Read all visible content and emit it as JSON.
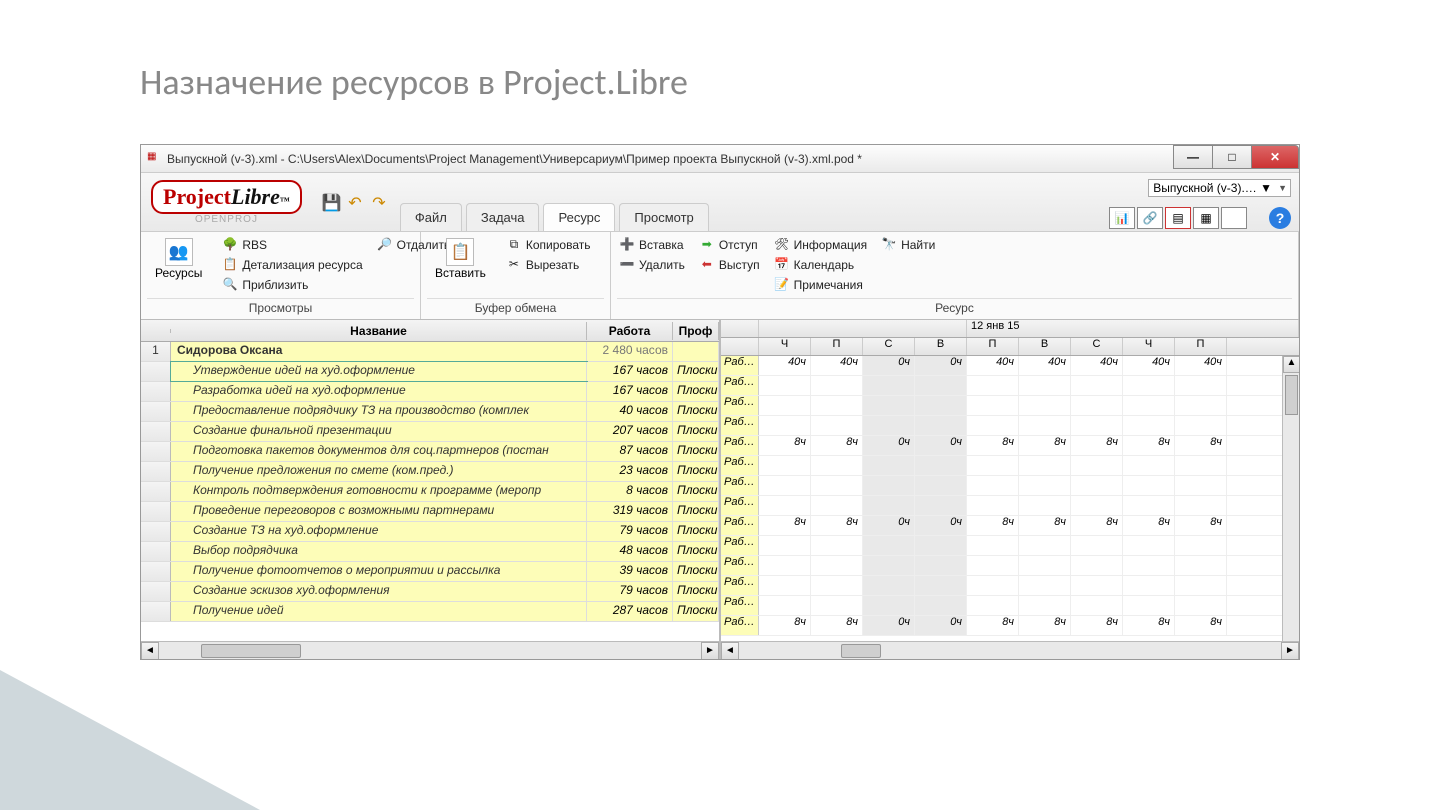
{
  "slide_title": "Назначение ресурсов в Project.Libre",
  "window": {
    "title": "Выпускной (v-3).xml - C:\\Users\\Alex\\Documents\\Project Management\\Универсариум\\Пример проекта Выпускной (v-3).xml.pod *",
    "brand_proj": "Project",
    "brand_libre": "Libre",
    "brand_tm": "™",
    "openproj": "OPENPROJ",
    "combo_text": "Выпускной (v-3).… ▼",
    "help": "?"
  },
  "tabs": {
    "file": "Файл",
    "task": "Задача",
    "resource": "Ресурс",
    "view": "Просмотр"
  },
  "ribbon": {
    "views_group": "Просмотры",
    "views_btn": "Ресурсы",
    "rbs": "RBS",
    "detail": "Детализация ресурса",
    "zoomin": "Приблизить",
    "zoomout": "Отдалить",
    "clipboard_group": "Буфер обмена",
    "paste": "Вставить",
    "copy": "Копировать",
    "cut": "Вырезать",
    "resource_group": "Ресурс",
    "insert": "Вставка",
    "delete": "Удалить",
    "indent": "Отступ",
    "outdent": "Выступ",
    "info": "Информация",
    "calendar": "Календарь",
    "notes": "Примечания",
    "find": "Найти"
  },
  "grid": {
    "col_name": "Название",
    "col_work": "Работа",
    "col_prof": "Проф",
    "date_header": "12 янв 15",
    "days": [
      "Ч",
      "П",
      "С",
      "В",
      "П",
      "В",
      "С",
      "Ч",
      "П"
    ],
    "rowlabel": "Раб…",
    "rows": [
      {
        "id": "1",
        "lvl": 1,
        "name": "Сидорова Оксана",
        "work": "2 480 часов",
        "prof": "",
        "vals": [
          "40ч",
          "40ч",
          "0ч",
          "0ч",
          "40ч",
          "40ч",
          "40ч",
          "40ч",
          "40ч"
        ]
      },
      {
        "id": "",
        "lvl": 2,
        "name": "Утверждение идей на худ.оформление",
        "work": "167 часов",
        "prof": "Плоски",
        "vals": [
          "",
          "",
          "",
          "",
          "",
          "",
          "",
          "",
          ""
        ]
      },
      {
        "id": "",
        "lvl": 2,
        "name": "Разработка идей на худ.оформление",
        "work": "167 часов",
        "prof": "Плоски",
        "vals": [
          "",
          "",
          "",
          "",
          "",
          "",
          "",
          "",
          ""
        ]
      },
      {
        "id": "",
        "lvl": 2,
        "name": "Предоставление подрядчику ТЗ на производство (комплек",
        "work": "40 часов",
        "prof": "Плоски",
        "vals": [
          "",
          "",
          "",
          "",
          "",
          "",
          "",
          "",
          ""
        ]
      },
      {
        "id": "",
        "lvl": 2,
        "name": "Создание финальной презентации",
        "work": "207 часов",
        "prof": "Плоски",
        "vals": [
          "8ч",
          "8ч",
          "0ч",
          "0ч",
          "8ч",
          "8ч",
          "8ч",
          "8ч",
          "8ч"
        ]
      },
      {
        "id": "",
        "lvl": 2,
        "name": "Подготовка пакетов документов для соц.партнеров (постан",
        "work": "87 часов",
        "prof": "Плоски",
        "vals": [
          "",
          "",
          "",
          "",
          "",
          "",
          "",
          "",
          ""
        ]
      },
      {
        "id": "",
        "lvl": 2,
        "name": "Получение предложения по смете (ком.пред.)",
        "work": "23 часов",
        "prof": "Плоски",
        "vals": [
          "",
          "",
          "",
          "",
          "",
          "",
          "",
          "",
          ""
        ]
      },
      {
        "id": "",
        "lvl": 2,
        "name": "Контроль подтверждения готовности к программе (меропр",
        "work": "8 часов",
        "prof": "Плоски",
        "vals": [
          "",
          "",
          "",
          "",
          "",
          "",
          "",
          "",
          ""
        ]
      },
      {
        "id": "",
        "lvl": 2,
        "name": "Проведение переговоров с возможными партнерами",
        "work": "319 часов",
        "prof": "Плоски",
        "vals": [
          "8ч",
          "8ч",
          "0ч",
          "0ч",
          "8ч",
          "8ч",
          "8ч",
          "8ч",
          "8ч"
        ]
      },
      {
        "id": "",
        "lvl": 2,
        "name": "Создание ТЗ на худ.оформление",
        "work": "79 часов",
        "prof": "Плоски",
        "vals": [
          "",
          "",
          "",
          "",
          "",
          "",
          "",
          "",
          ""
        ]
      },
      {
        "id": "",
        "lvl": 2,
        "name": "Выбор подрядчика",
        "work": "48 часов",
        "prof": "Плоски",
        "vals": [
          "",
          "",
          "",
          "",
          "",
          "",
          "",
          "",
          ""
        ]
      },
      {
        "id": "",
        "lvl": 2,
        "name": "Получение фотоотчетов о мероприятии и рассылка",
        "work": "39 часов",
        "prof": "Плоски",
        "vals": [
          "",
          "",
          "",
          "",
          "",
          "",
          "",
          "",
          ""
        ]
      },
      {
        "id": "",
        "lvl": 2,
        "name": "Создание эскизов худ.оформления",
        "work": "79 часов",
        "prof": "Плоски",
        "vals": [
          "",
          "",
          "",
          "",
          "",
          "",
          "",
          "",
          ""
        ]
      },
      {
        "id": "",
        "lvl": 2,
        "name": "Получение идей",
        "work": "287 часов",
        "prof": "Плоски",
        "vals": [
          "8ч",
          "8ч",
          "0ч",
          "0ч",
          "8ч",
          "8ч",
          "8ч",
          "8ч",
          "8ч"
        ]
      }
    ]
  }
}
